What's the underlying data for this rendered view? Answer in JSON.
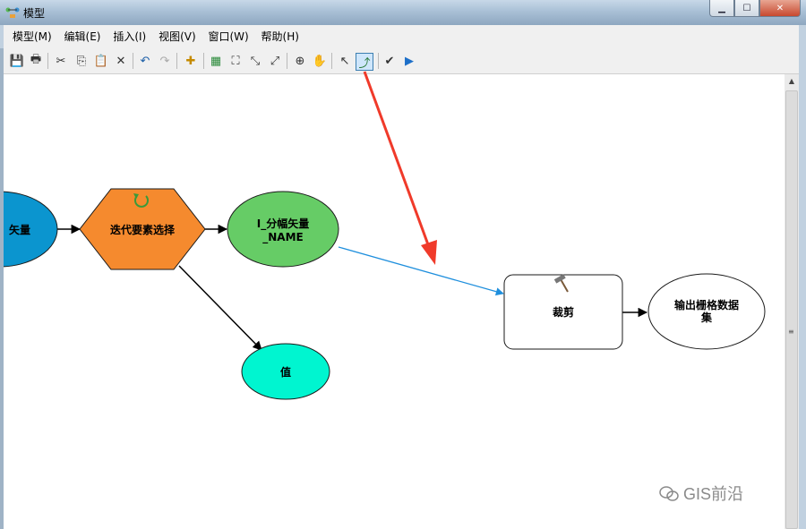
{
  "window": {
    "title": "模型",
    "minimize": "▁",
    "maximize": "☐",
    "close": "✕"
  },
  "menu": [
    "模型(M)",
    "编辑(E)",
    "插入(I)",
    "视图(V)",
    "窗口(W)",
    "帮助(H)"
  ],
  "toolbar": {
    "buttons": [
      {
        "name": "save-icon",
        "glyph": "💾"
      },
      {
        "name": "print-icon",
        "glyph": "🖶"
      },
      {
        "name": "cut-icon",
        "glyph": "✂"
      },
      {
        "name": "copy-icon",
        "glyph": "⎘"
      },
      {
        "name": "paste-icon",
        "glyph": "📋"
      },
      {
        "name": "delete-icon",
        "glyph": "✕"
      },
      {
        "name": "undo-icon",
        "glyph": "↶"
      },
      {
        "name": "redo-icon",
        "glyph": "↷"
      },
      {
        "name": "add-data-icon",
        "glyph": "✚"
      },
      {
        "name": "auto-layout-icon",
        "glyph": "▦"
      },
      {
        "name": "full-extent-icon",
        "glyph": "⛶"
      },
      {
        "name": "zoom-in-fixed-icon",
        "glyph": "⤡"
      },
      {
        "name": "zoom-out-fixed-icon",
        "glyph": "⤢"
      },
      {
        "name": "zoom-in-icon",
        "glyph": "⊕"
      },
      {
        "name": "pan-icon",
        "glyph": "✋"
      },
      {
        "name": "select-icon",
        "glyph": "↖"
      },
      {
        "name": "add-connection-icon",
        "glyph": "⤴"
      },
      {
        "name": "validate-icon",
        "glyph": "✔"
      },
      {
        "name": "run-icon",
        "glyph": "▶"
      }
    ]
  },
  "nodes": {
    "input_vector": "矢量",
    "iterator": "迭代要素选择",
    "output_value_line1": "I_分幅矢量",
    "output_value_line2": "_NAME",
    "value": "值",
    "clip": "裁剪",
    "output_raster_line1": "输出栅格数据",
    "output_raster_line2": "集"
  },
  "colors": {
    "input": "#0b95cf",
    "iterator": "#f58a2e",
    "derived": "#66cc66",
    "value": "#00f5d0",
    "connection": "#1f8fdd",
    "annotation_arrow": "#f03a2a"
  },
  "watermark": "GIS前沿"
}
